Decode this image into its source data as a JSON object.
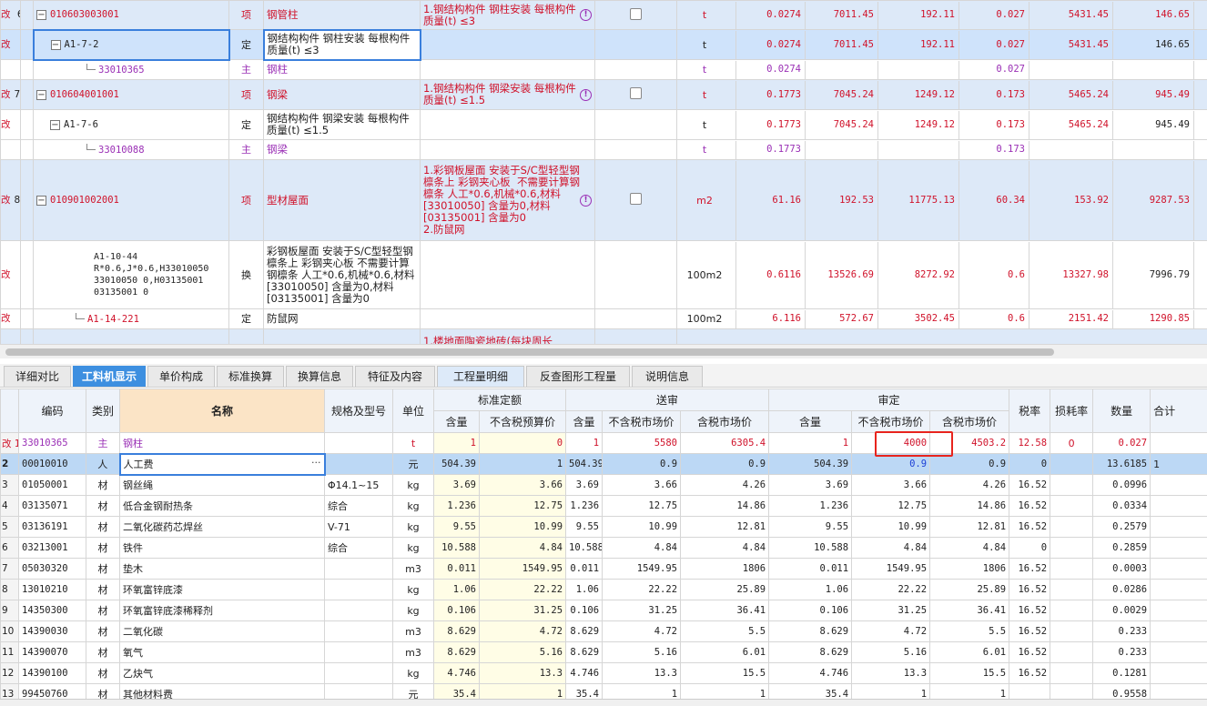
{
  "top_rows": [
    {
      "kind": "qd",
      "rownum": "6",
      "left": "改 ",
      "code": "010603003001",
      "type": "项",
      "name": "钢管柱",
      "feature": "1.钢结构构件 钢柱安装 每根构件质量(t) ≤3",
      "unit": "t",
      "qty": "0.0274",
      "price": "7011.45",
      "total": "192.11",
      "qty2": "0.027",
      "price2": "5431.45",
      "total2": "146.65"
    },
    {
      "kind": "de-sel",
      "left": "改",
      "code": "A1-7-2",
      "type": "定",
      "name": "钢结构构件 钢柱安装 每根构件质量(t) ≤3",
      "unit": "t",
      "qty": "0.0274",
      "price": "7011.45",
      "total": "192.11",
      "qty2": "0.027",
      "price2": "5431.45",
      "total2": "146.65"
    },
    {
      "kind": "zc",
      "code": "33010365",
      "type": "主",
      "name": "钢柱",
      "unit": "t",
      "qty": "0.0274",
      "qty2": "0.027"
    },
    {
      "kind": "qd",
      "rownum": "7",
      "left": "改",
      "code": "010604001001",
      "type": "项",
      "name": "钢梁",
      "feature": "1.钢结构构件 钢梁安装 每根构件质量(t) ≤1.5",
      "unit": "t",
      "qty": "0.1773",
      "price": "7045.24",
      "total": "1249.12",
      "qty2": "0.173",
      "price2": "5465.24",
      "total2": "945.49"
    },
    {
      "kind": "de",
      "left": "改",
      "code": "A1-7-6",
      "type": "定",
      "name": "钢结构构件 钢梁安装 每根构件质量(t) ≤1.5",
      "unit": "t",
      "qty": "0.1773",
      "price": "7045.24",
      "total": "1249.12",
      "qty2": "0.173",
      "price2": "5465.24",
      "total2": "945.49"
    },
    {
      "kind": "zc",
      "code": "33010088",
      "type": "主",
      "name": "钢梁",
      "unit": "t",
      "qty": "0.1773",
      "qty2": "0.173"
    },
    {
      "kind": "qd",
      "rownum": "8",
      "left": "改",
      "code": "010901002001",
      "type": "项",
      "name": "型材屋面",
      "feature": "1.彩钢板屋面 安装于S/C型轻型钢檩条上 彩钢夹心板  不需要计算钢檩条 人工*0.6,机械*0.6,材料[33010050] 含量为0,材料[03135001] 含量为0\n2.防鼠网",
      "unit": "m2",
      "qty": "61.16",
      "price": "192.53",
      "total": "11775.13",
      "qty2": "60.34",
      "price2": "153.92",
      "total2": "9287.53"
    },
    {
      "kind": "de",
      "left": "改",
      "code": "A1-10-44\nR*0.6,J*0.6,H33010050 33010050 0,H03135001 03135001 0",
      "type": "换",
      "name": "彩钢板屋面 安装于S/C型轻型钢檩条上 彩钢夹心板  不需要计算钢檩条 人工*0.6,机械*0.6,材料[33010050] 含量为0,材料[03135001] 含量为0",
      "unit": "100m2",
      "qty": "0.6116",
      "price": "13526.69",
      "total": "8272.92",
      "qty2": "0.6",
      "price2": "13327.98",
      "total2": "7996.79"
    },
    {
      "kind": "de-red",
      "left": "改",
      "code": "A1-14-221",
      "type": "定",
      "name": "防鼠网",
      "unit": "100m2",
      "qty": "6.116",
      "price": "572.67",
      "total": "3502.45",
      "qty2": "0.6",
      "price2": "2151.42",
      "total2": "1290.85"
    },
    {
      "kind": "cut",
      "feature": "1.楼地面陶瓷地砖(每块周长"
    }
  ],
  "tabs": [
    "详细对比",
    "工料机显示",
    "单价构成",
    "标准换算",
    "换算信息",
    "特征及内容",
    "工程量明细",
    "反查图形工程量",
    "说明信息"
  ],
  "headers": {
    "code": "编码",
    "type": "类别",
    "name": "名称",
    "spec": "规格及型号",
    "unit": "单位",
    "group_std": "标准定额",
    "group_send": "送审",
    "group_audit": "审定",
    "qty": "含量",
    "std_price": "不含税预算价",
    "market_ex": "不含税市场价",
    "market_in": "含税市场价",
    "tax": "税率",
    "loss": "损耗率",
    "amount": "数量",
    "total": "合计"
  },
  "bottom_rows": [
    {
      "rn": "改 1",
      "code": "33010365",
      "type": "主",
      "name": "钢柱",
      "spec": "",
      "unit": "t",
      "q1": "1",
      "p1": "0",
      "q2": "1",
      "p2": "5580",
      "p3": "6305.4",
      "q3": "1",
      "p4": "4000",
      "p5": "4503.2",
      "tax": "12.58",
      "loss": "0",
      "amt": "0.027",
      "cls": "main"
    },
    {
      "rn": "2",
      "code": "00010010",
      "type": "人",
      "name": "人工费",
      "spec": "",
      "unit": "元",
      "q1": "504.39",
      "p1": "1",
      "q2": "504.39",
      "p2": "0.9",
      "p3": "0.9",
      "q3": "504.39",
      "p4": "0.9",
      "p5": "0.9",
      "tax": "0",
      "loss": "",
      "amt": "13.6185",
      "cls": "sel",
      "more": "···",
      "total_edge": "1"
    },
    {
      "rn": "3",
      "code": "01050001",
      "type": "材",
      "name": "钢丝绳",
      "spec": "Φ14.1~15",
      "unit": "kg",
      "q1": "3.69",
      "p1": "3.66",
      "q2": "3.69",
      "p2": "3.66",
      "p3": "4.26",
      "q3": "3.69",
      "p4": "3.66",
      "p5": "4.26",
      "tax": "16.52",
      "loss": "",
      "amt": "0.0996"
    },
    {
      "rn": "4",
      "code": "03135071",
      "type": "材",
      "name": "低合金钢耐热条",
      "spec": "综合",
      "unit": "kg",
      "q1": "1.236",
      "p1": "12.75",
      "q2": "1.236",
      "p2": "12.75",
      "p3": "14.86",
      "q3": "1.236",
      "p4": "12.75",
      "p5": "14.86",
      "tax": "16.52",
      "loss": "",
      "amt": "0.0334"
    },
    {
      "rn": "5",
      "code": "03136191",
      "type": "材",
      "name": "二氧化碳药芯焊丝",
      "spec": "V-71",
      "unit": "kg",
      "q1": "9.55",
      "p1": "10.99",
      "q2": "9.55",
      "p2": "10.99",
      "p3": "12.81",
      "q3": "9.55",
      "p4": "10.99",
      "p5": "12.81",
      "tax": "16.52",
      "loss": "",
      "amt": "0.2579"
    },
    {
      "rn": "6",
      "code": "03213001",
      "type": "材",
      "name": "铁件",
      "spec": "综合",
      "unit": "kg",
      "q1": "10.588",
      "p1": "4.84",
      "q2": "10.588",
      "p2": "4.84",
      "p3": "4.84",
      "q3": "10.588",
      "p4": "4.84",
      "p5": "4.84",
      "tax": "0",
      "loss": "",
      "amt": "0.2859"
    },
    {
      "rn": "7",
      "code": "05030320",
      "type": "材",
      "name": "垫木",
      "spec": "",
      "unit": "m3",
      "q1": "0.011",
      "p1": "1549.95",
      "q2": "0.011",
      "p2": "1549.95",
      "p3": "1806",
      "q3": "0.011",
      "p4": "1549.95",
      "p5": "1806",
      "tax": "16.52",
      "loss": "",
      "amt": "0.0003"
    },
    {
      "rn": "8",
      "code": "13010210",
      "type": "材",
      "name": "环氧富锌底漆",
      "spec": "",
      "unit": "kg",
      "q1": "1.06",
      "p1": "22.22",
      "q2": "1.06",
      "p2": "22.22",
      "p3": "25.89",
      "q3": "1.06",
      "p4": "22.22",
      "p5": "25.89",
      "tax": "16.52",
      "loss": "",
      "amt": "0.0286"
    },
    {
      "rn": "9",
      "code": "14350300",
      "type": "材",
      "name": "环氧富锌底漆稀释剂",
      "spec": "",
      "unit": "kg",
      "q1": "0.106",
      "p1": "31.25",
      "q2": "0.106",
      "p2": "31.25",
      "p3": "36.41",
      "q3": "0.106",
      "p4": "31.25",
      "p5": "36.41",
      "tax": "16.52",
      "loss": "",
      "amt": "0.0029"
    },
    {
      "rn": "10",
      "code": "14390030",
      "type": "材",
      "name": "二氧化碳",
      "spec": "",
      "unit": "m3",
      "q1": "8.629",
      "p1": "4.72",
      "q2": "8.629",
      "p2": "4.72",
      "p3": "5.5",
      "q3": "8.629",
      "p4": "4.72",
      "p5": "5.5",
      "tax": "16.52",
      "loss": "",
      "amt": "0.233"
    },
    {
      "rn": "11",
      "code": "14390070",
      "type": "材",
      "name": "氧气",
      "spec": "",
      "unit": "m3",
      "q1": "8.629",
      "p1": "5.16",
      "q2": "8.629",
      "p2": "5.16",
      "p3": "6.01",
      "q3": "8.629",
      "p4": "5.16",
      "p5": "6.01",
      "tax": "16.52",
      "loss": "",
      "amt": "0.233"
    },
    {
      "rn": "12",
      "code": "14390100",
      "type": "材",
      "name": "乙炔气",
      "spec": "",
      "unit": "kg",
      "q1": "4.746",
      "p1": "13.3",
      "q2": "4.746",
      "p2": "13.3",
      "p3": "15.5",
      "q3": "4.746",
      "p4": "13.3",
      "p5": "15.5",
      "tax": "16.52",
      "loss": "",
      "amt": "0.1281"
    },
    {
      "rn": "13",
      "code": "99450760",
      "type": "材",
      "name": "其他材料费",
      "spec": "",
      "unit": "元",
      "q1": "35.4",
      "p1": "1",
      "q2": "35.4",
      "p2": "1",
      "p3": "1",
      "q3": "35.4",
      "p4": "1",
      "p5": "1",
      "tax": "",
      "loss": "",
      "amt": "0.9558"
    }
  ]
}
